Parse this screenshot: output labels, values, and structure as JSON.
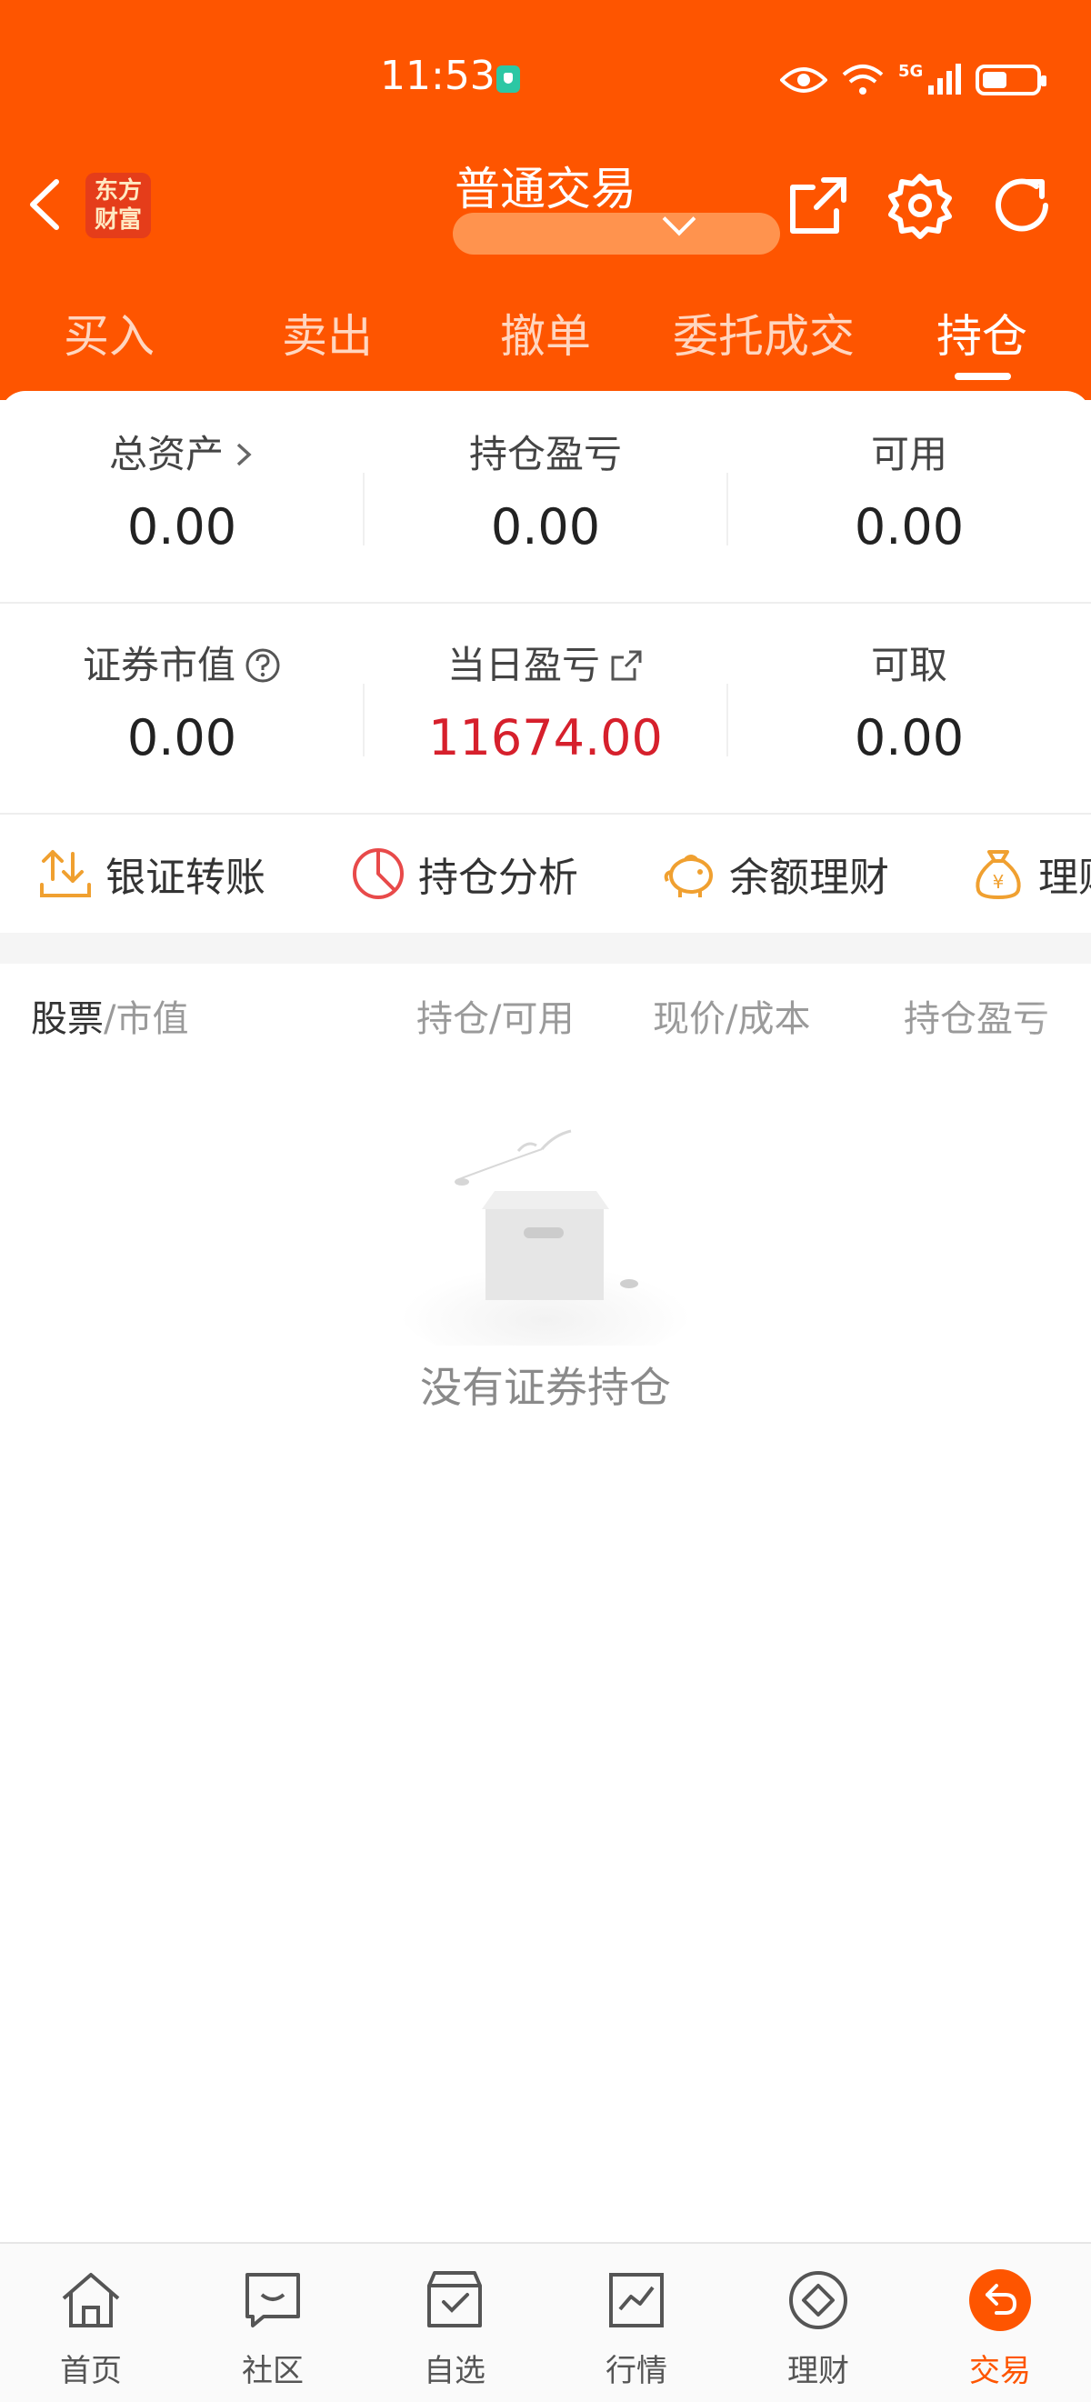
{
  "status_bar": {
    "time": "11:53",
    "network": "5G"
  },
  "header": {
    "logo_text": "东方财富",
    "title": "普通交易",
    "tabs": [
      {
        "label": "买入",
        "active": false
      },
      {
        "label": "卖出",
        "active": false
      },
      {
        "label": "撤单",
        "active": false
      },
      {
        "label": "委托成交",
        "active": false
      },
      {
        "label": "持仓",
        "active": true
      }
    ]
  },
  "summary": {
    "total_assets": {
      "label": "总资产",
      "value": "0.00"
    },
    "position_pnl": {
      "label": "持仓盈亏",
      "value": "0.00"
    },
    "available": {
      "label": "可用",
      "value": "0.00"
    },
    "market_value": {
      "label": "证券市值",
      "value": "0.00"
    },
    "daily_pnl": {
      "label": "当日盈亏",
      "value": "11674.00"
    },
    "withdrawable": {
      "label": "可取",
      "value": "0.00"
    }
  },
  "quick_actions": [
    {
      "label": "银证转账",
      "icon": "transfer-icon"
    },
    {
      "label": "持仓分析",
      "icon": "pie-chart-icon"
    },
    {
      "label": "余额理财",
      "icon": "piggy-bank-icon"
    },
    {
      "label": "理财",
      "icon": "money-bag-icon"
    }
  ],
  "list_header": {
    "col1_main": "股票",
    "col1_sub": "/市值",
    "col2": "持仓/可用",
    "col3": "现价/成本",
    "col4": "持仓盈亏"
  },
  "empty_state": {
    "message": "没有证券持仓"
  },
  "bottom_nav": [
    {
      "label": "首页",
      "icon": "home-icon",
      "active": false
    },
    {
      "label": "社区",
      "icon": "community-icon",
      "active": false
    },
    {
      "label": "自选",
      "icon": "watchlist-icon",
      "active": false
    },
    {
      "label": "行情",
      "icon": "market-icon",
      "active": false
    },
    {
      "label": "理财",
      "icon": "wealth-icon",
      "active": false
    },
    {
      "label": "交易",
      "icon": "trade-icon",
      "active": true
    }
  ],
  "colors": {
    "brand": "#fe5500",
    "loss_gain_red": "#d6202c",
    "quick_icon": "#f0a030"
  }
}
